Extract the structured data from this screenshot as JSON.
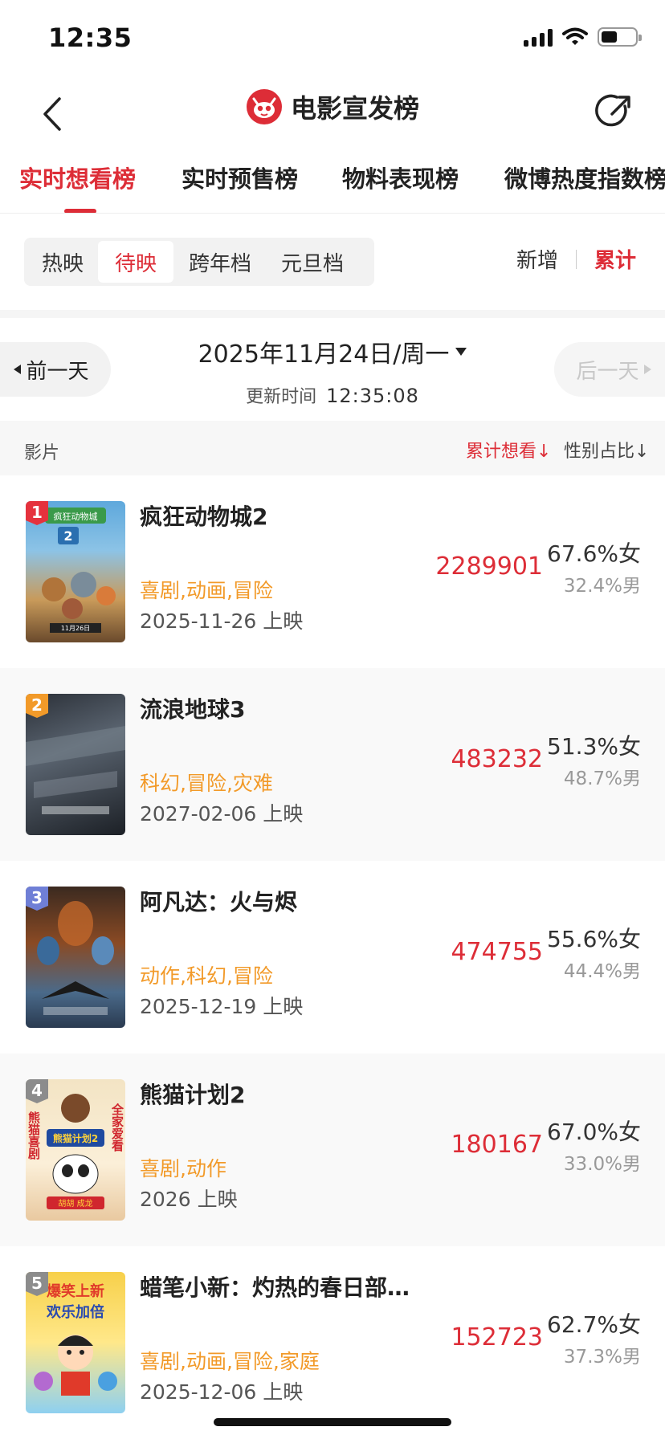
{
  "status_bar": {
    "time": "12:35"
  },
  "header": {
    "title": "电影宣发榜"
  },
  "tabs": [
    {
      "label": "实时想看榜",
      "active": true
    },
    {
      "label": "实时预售榜",
      "active": false
    },
    {
      "label": "物料表现榜",
      "active": false
    },
    {
      "label": "微博热度指数榜",
      "active": false
    }
  ],
  "segments": [
    {
      "label": "热映",
      "active": false
    },
    {
      "label": "待映",
      "active": true
    },
    {
      "label": "跨年档",
      "active": false
    },
    {
      "label": "元旦档",
      "active": false
    }
  ],
  "toggle": {
    "new_label": "新增",
    "total_label": "累计",
    "selected": "累计"
  },
  "date_nav": {
    "prev_label": "前一天",
    "next_label": "后一天",
    "date": "2025年11月24日/周一",
    "update_label": "更新时间",
    "update_time": "12:35:08"
  },
  "table_header": {
    "film": "影片",
    "want": "累计想看↓",
    "gender": "性别占比↓"
  },
  "movies": [
    {
      "rank": "1",
      "title": "疯狂动物城2",
      "genre": "喜剧,动画,冒险",
      "release": "2025-11-26 上映",
      "want": "2289901",
      "female": "67.6%女",
      "male": "32.4%男"
    },
    {
      "rank": "2",
      "title": "流浪地球3",
      "genre": "科幻,冒险,灾难",
      "release": "2027-02-06 上映",
      "want": "483232",
      "female": "51.3%女",
      "male": "48.7%男"
    },
    {
      "rank": "3",
      "title": "阿凡达：火与烬",
      "genre": "动作,科幻,冒险",
      "release": "2025-12-19 上映",
      "want": "474755",
      "female": "55.6%女",
      "male": "44.4%男"
    },
    {
      "rank": "4",
      "title": "熊猫计划2",
      "genre": "喜剧,动作",
      "release": "2026 上映",
      "want": "180167",
      "female": "67.0%女",
      "male": "33.0%男"
    },
    {
      "rank": "5",
      "title": "蜡笔小新：灼热的春日部…",
      "genre": "喜剧,动画,冒险,家庭",
      "release": "2025-12-06 上映",
      "want": "152723",
      "female": "62.7%女",
      "male": "37.3%男"
    }
  ],
  "colors": {
    "accent": "#dd2d37",
    "genre": "#f29a29"
  },
  "poster_texts": {
    "p1_top": "疯狂动物城",
    "p1_num": "2",
    "p1_date": "11月26日",
    "p4_left": "熊猫喜剧",
    "p4_right": "全家爱看",
    "p4_logo": "熊猫计划2",
    "p4_names": "胡胡 成龙",
    "p5_top": "爆笑上新",
    "p5_mid": "欢乐加倍"
  }
}
